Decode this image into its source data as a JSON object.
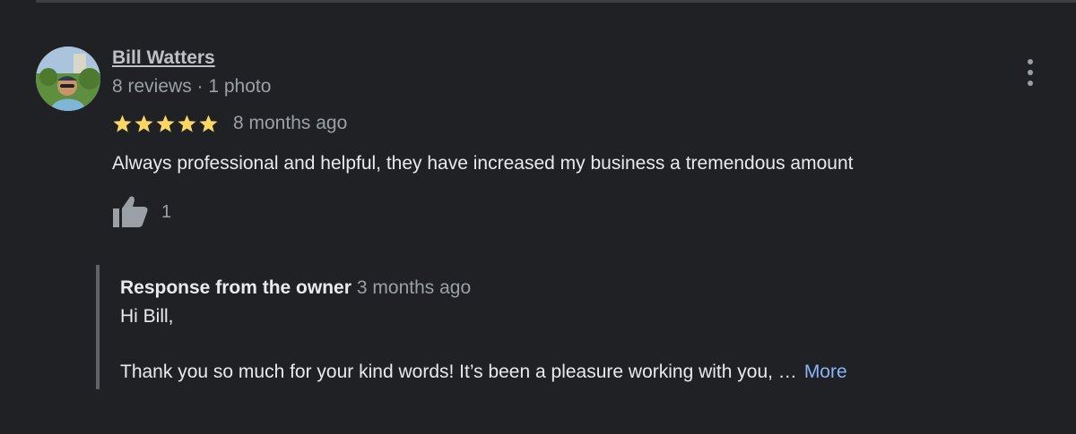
{
  "review": {
    "reviewer_name": "Bill Watters",
    "reviewer_meta": "8 reviews · 1 photo",
    "rating": 5,
    "rating_max": 5,
    "time": "8 months ago",
    "text": "Always professional and helpful, they have increased my business a tremendous amount",
    "like_count": "1"
  },
  "owner_response": {
    "label": "Response from the owner",
    "time": "3 months ago",
    "greeting": "Hi Bill,",
    "body": "Thank you so much for your kind words! It’s been a pleasure working with you, …",
    "more_label": "More"
  },
  "icons": {
    "avatar": "avatar-photo",
    "menu": "more-vert-icon",
    "star": "star-icon",
    "like": "thumbs-up-icon"
  },
  "colors": {
    "background": "#202124",
    "star": "#fdd663",
    "link": "#8ab4f8",
    "secondary_text": "#9aa0a6"
  }
}
